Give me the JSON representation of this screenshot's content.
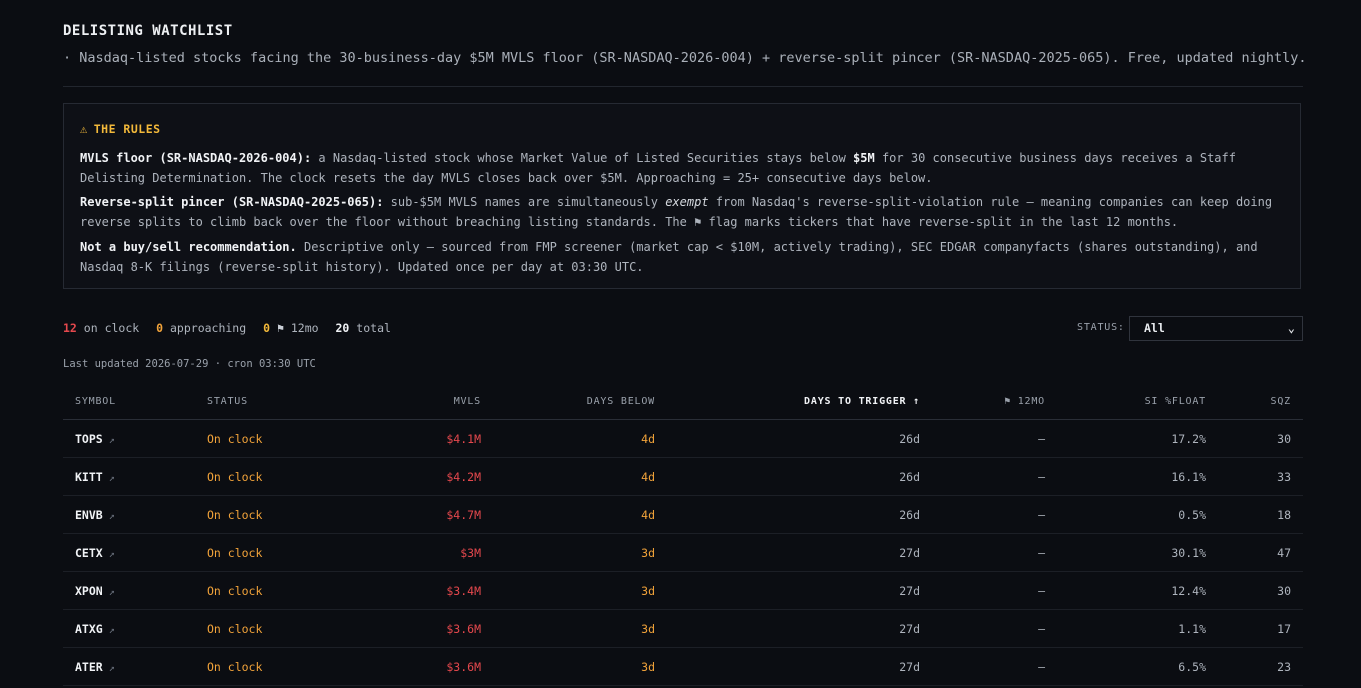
{
  "header": {
    "title": "DELISTING WATCHLIST",
    "subtitle": "· Nasdaq-listed stocks facing the 30-business-day $5M MVLS floor (SR-NASDAQ-2026-004) + reverse-split pincer (SR-NASDAQ-2025-065). Free, updated nightly."
  },
  "rules": {
    "heading": "THE RULES",
    "p1_bold": "MVLS floor (SR-NASDAQ-2026-004):",
    "p1_a": " a Nasdaq-listed stock whose Market Value of Listed Securities stays below ",
    "p1_b": "$5M",
    "p1_c": " for 30 consecutive business days receives a Staff Delisting Determination. The clock resets the day MVLS closes back over $5M. Approaching = 25+ consecutive days below.",
    "p2_bold": "Reverse-split pincer (SR-NASDAQ-2025-065):",
    "p2_a": " sub-$5M MVLS names are simultaneously ",
    "p2_i": "exempt",
    "p2_b": " from Nasdaq's reverse-split-violation rule — meaning companies can keep doing reverse splits to climb back over the floor without breaching listing standards. The ⚑ flag marks tickers that have reverse-split in the last 12 months.",
    "p3_bold": "Not a buy/sell recommendation.",
    "p3_a": " Descriptive only — sourced from FMP screener (market cap < $10M, actively trading), SEC EDGAR companyfacts (shares outstanding), and Nasdaq 8-K filings (reverse-split history). Updated once per day at 03:30 UTC."
  },
  "summary": {
    "on_clock_count": "12",
    "on_clock_label": "on clock",
    "approaching_count": "0",
    "approaching_label": "approaching",
    "flag_count": "0",
    "flag_glyph": "⚑",
    "flag_label": "12mo",
    "total_count": "20",
    "total_label": "total"
  },
  "filter": {
    "label": "STATUS:",
    "selected": "All"
  },
  "last_updated": "Last updated 2026-07-29 · cron 03:30 UTC",
  "table": {
    "headers": {
      "symbol": "SYMBOL",
      "status": "STATUS",
      "mvls": "MVLS",
      "days_below": "DAYS BELOW",
      "days_to_trigger": "DAYS TO TRIGGER ↑",
      "flag_12mo": "⚑ 12MO",
      "si_float": "SI %FLOAT",
      "sqz": "SQZ"
    },
    "rows": [
      {
        "symbol": "TOPS",
        "status": "On clock",
        "mvls": "$4.1M",
        "days_below": "4d",
        "days_to_trigger": "26d",
        "flag": "—",
        "si_float": "17.2%",
        "sqz": "30"
      },
      {
        "symbol": "KITT",
        "status": "On clock",
        "mvls": "$4.2M",
        "days_below": "4d",
        "days_to_trigger": "26d",
        "flag": "—",
        "si_float": "16.1%",
        "sqz": "33"
      },
      {
        "symbol": "ENVB",
        "status": "On clock",
        "mvls": "$4.7M",
        "days_below": "4d",
        "days_to_trigger": "26d",
        "flag": "—",
        "si_float": "0.5%",
        "sqz": "18"
      },
      {
        "symbol": "CETX",
        "status": "On clock",
        "mvls": "$3M",
        "days_below": "3d",
        "days_to_trigger": "27d",
        "flag": "—",
        "si_float": "30.1%",
        "sqz": "47"
      },
      {
        "symbol": "XPON",
        "status": "On clock",
        "mvls": "$3.4M",
        "days_below": "3d",
        "days_to_trigger": "27d",
        "flag": "—",
        "si_float": "12.4%",
        "sqz": "30"
      },
      {
        "symbol": "ATXG",
        "status": "On clock",
        "mvls": "$3.6M",
        "days_below": "3d",
        "days_to_trigger": "27d",
        "flag": "—",
        "si_float": "1.1%",
        "sqz": "17"
      },
      {
        "symbol": "ATER",
        "status": "On clock",
        "mvls": "$3.6M",
        "days_below": "3d",
        "days_to_trigger": "27d",
        "flag": "—",
        "si_float": "6.5%",
        "sqz": "23"
      }
    ]
  },
  "icons": {
    "warning": "warning-icon",
    "external_link": "external-link-icon",
    "chevron": "chevron-down-icon"
  },
  "colors": {
    "background": "#0b0d12",
    "red": "#e5484d",
    "orange": "#f2a33a",
    "gold": "#f3b93a"
  }
}
